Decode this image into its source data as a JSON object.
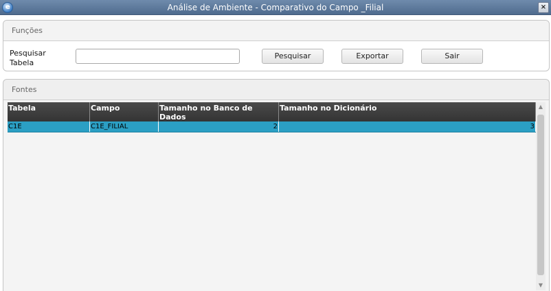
{
  "window": {
    "title": "Análise de Ambiente - Comparativo do Campo _Filial",
    "app_icon": "totvs-app-icon",
    "close_glyph": "×"
  },
  "funcoes": {
    "header": "Funções",
    "search_label": "Pesquisar Tabela",
    "search_value": "",
    "buttons": {
      "pesquisar": "Pesquisar",
      "exportar": "Exportar",
      "sair": "Sair"
    }
  },
  "fontes": {
    "header": "Fontes",
    "columns": [
      "Tabela",
      "Campo",
      "Tamanho no Banco de Dados",
      "Tamanho no Dicionário"
    ],
    "rows": [
      {
        "tabela": "C1E",
        "campo": "C1E_FILIAL",
        "tamanho_banco": "2",
        "tamanho_dicionario": "3"
      }
    ]
  },
  "colors": {
    "title_bar": "#5a769a",
    "header_row": "#3c3c3c",
    "selected_row": "#2b9fc4"
  }
}
